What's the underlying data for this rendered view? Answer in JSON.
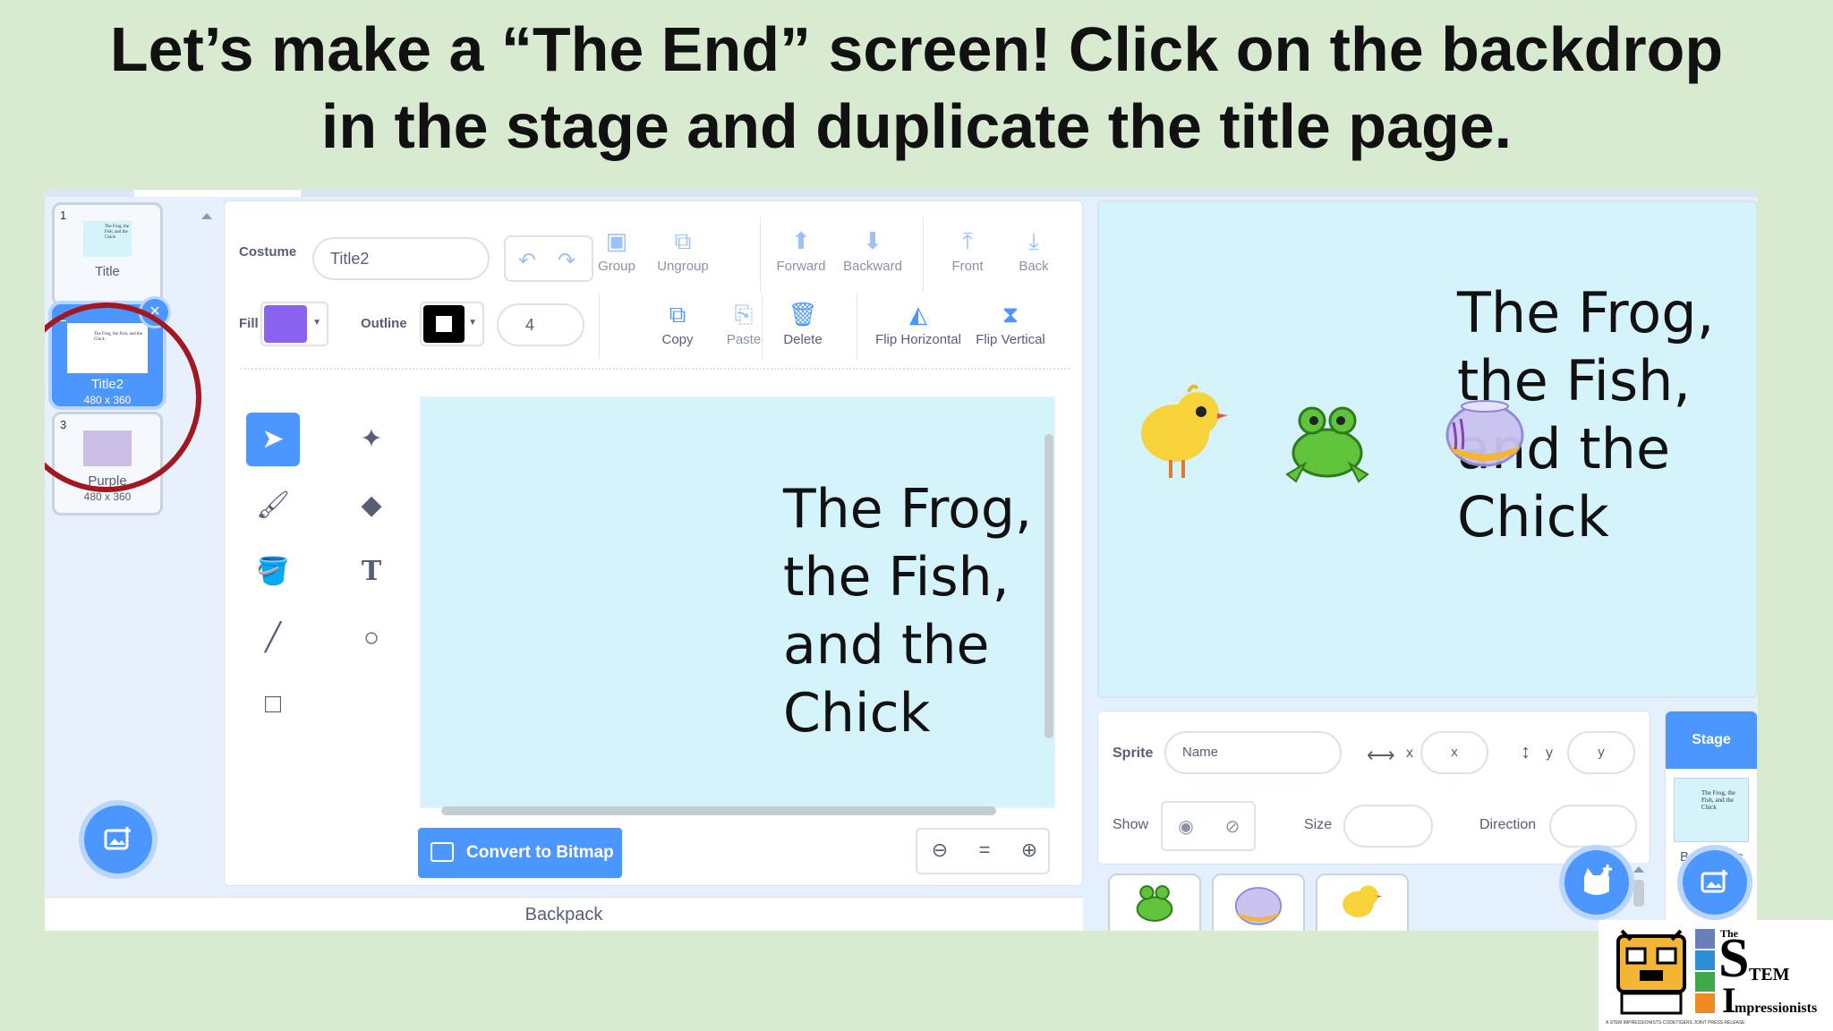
{
  "heading": {
    "line1": "Let’s make a “The End” screen! Click on the backdrop",
    "line2": "in the stage and duplicate the title page."
  },
  "costume_list": {
    "items": [
      {
        "num": "1",
        "name": "Title",
        "size": ""
      },
      {
        "num": "2",
        "name": "Title2",
        "size": "480 x 360"
      },
      {
        "num": "3",
        "name": "Purple",
        "size": "480 x 360"
      }
    ],
    "thumb_text": "The Frog, the Fish, and the Chick",
    "delete_glyph": "✕"
  },
  "editor": {
    "costume_label": "Costume",
    "costume_name": "Title2",
    "fill_label": "Fill",
    "outline_label": "Outline",
    "outline_width": "4",
    "fill_color": "#8a63f1",
    "tools_row1": [
      "Group",
      "Ungroup",
      "Forward",
      "Backward",
      "Front",
      "Back"
    ],
    "tools_row2": [
      "Copy",
      "Paste",
      "Delete",
      "Flip Horizontal",
      "Flip Vertical"
    ],
    "canvas_text": [
      "The Frog,",
      "the Fish,",
      "and the",
      "Chick"
    ],
    "convert_label": "Convert to Bitmap",
    "zoom_equal": "="
  },
  "backpack_label": "Backpack",
  "stage": {
    "title_lines": [
      "The Frog,",
      "the Fish,",
      "and the",
      "Chick"
    ]
  },
  "sprite_info": {
    "sprite_label": "Sprite",
    "name_placeholder": "Name",
    "x_label": "x",
    "x_placeholder": "x",
    "y_label": "y",
    "y_placeholder": "y",
    "show_label": "Show",
    "size_label": "Size",
    "direction_label": "Direction"
  },
  "stage_pane": {
    "header": "Stage",
    "backdrops_label": "Backdrops",
    "thumb_text": "The Frog, the Fish, and the Chick"
  },
  "logo": {
    "the": "The",
    "stem": "TEM",
    "impressionists": "mpressionists",
    "tagline": "A STEM IMPRESSIONISTS-CODETIGERS JOINT PRESS RELEASE"
  },
  "colors": {
    "accent": "#4c97ff",
    "highlight_ring": "#a11820",
    "stage_bg": "#d4f3fb",
    "page_bg": "#d8ead0"
  }
}
